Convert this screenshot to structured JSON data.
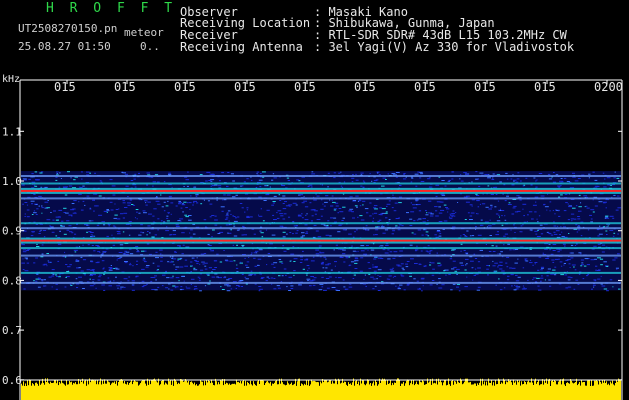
{
  "header": {
    "title": "H R O F F T",
    "filename": "UT2508270150.pn",
    "mode": "meteor",
    "datetime": "25.08.27 01:50",
    "small_text": "0.."
  },
  "info": [
    {
      "label": "Observer",
      "value": ": Masaki Kano"
    },
    {
      "label": "Receiving Location",
      "value": ": Shibukawa, Gunma, Japan"
    },
    {
      "label": "Receiver",
      "value": ": RTL-SDR SDR# 43dB L15 103.2MHz CW"
    },
    {
      "label": "Receiving Antenna",
      "value": ": 3el Yagi(V) Az 330 for Vladivostok"
    }
  ],
  "colors": {
    "background": "#000000",
    "text": "#e8e8e8",
    "title_green": "#2fd94a",
    "grid": "#ffffff",
    "signal_yellow": "#ffe600",
    "noise_blue": "#1a2bd8",
    "band_cyan": "#20d0e0",
    "band_red": "#ff2020"
  },
  "chart_data": {
    "type": "heatmap",
    "title": "H R O F F T",
    "xlabel": "",
    "ylabel": "kHz",
    "x_tick_labels": [
      "015",
      "015",
      "015",
      "015",
      "015",
      "015",
      "015",
      "015",
      "015",
      "0200"
    ],
    "y_tick_labels": [
      "1.1",
      "1.0",
      "0.9",
      "0.8",
      "0.7",
      "0.6"
    ],
    "y_ticks": [
      1.1,
      1.0,
      0.9,
      0.8,
      0.7,
      0.6
    ],
    "ylim": [
      0.6,
      1.2
    ],
    "noise_band_khz": [
      0.78,
      1.02
    ],
    "strong_lines_khz": [
      0.98,
      0.88
    ],
    "medium_lines_khz": [
      1.01,
      0.995,
      0.965,
      0.915,
      0.905,
      0.865,
      0.85,
      0.815,
      0.795
    ],
    "signal_strip_level": 0.95,
    "grid": true
  }
}
